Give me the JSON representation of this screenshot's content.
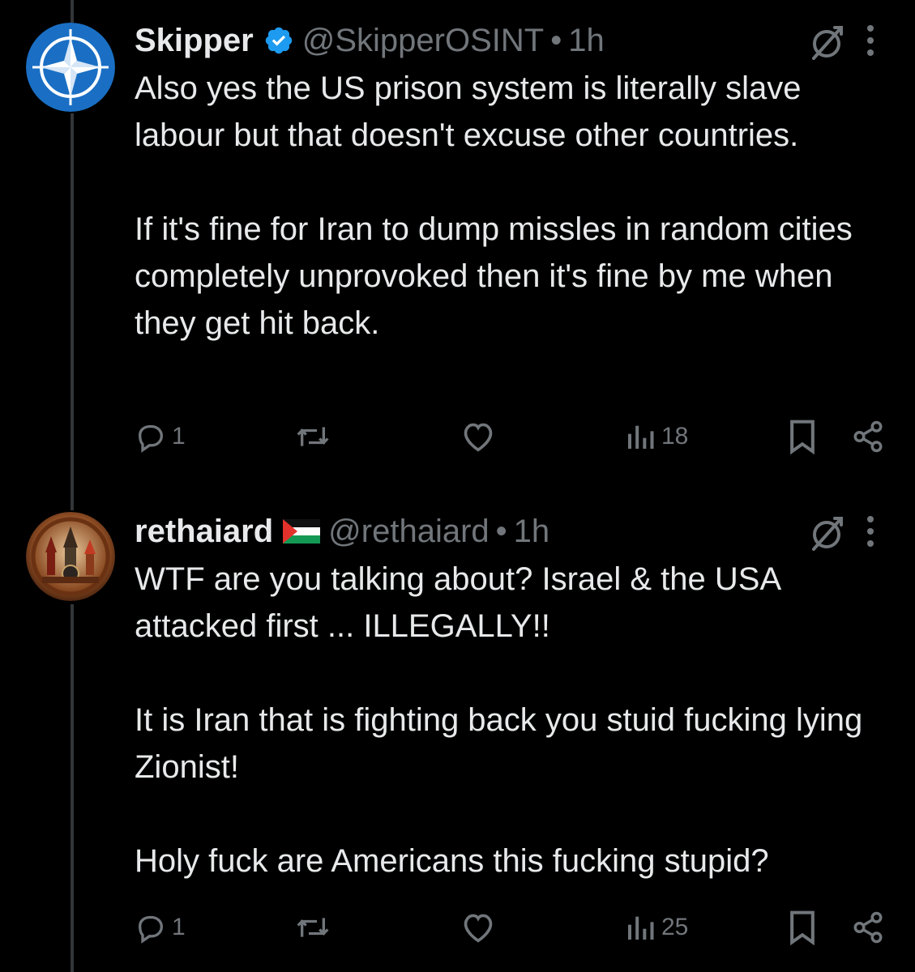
{
  "posts": [
    {
      "name": "Skipper",
      "verified": true,
      "handle": "@SkipperOSINT",
      "separator": "•",
      "time": "1h",
      "paragraphs": [
        "Also yes the US prison system is literally slave labour but that doesn't excuse other countries.",
        "If it's fine for Iran to dump missles in random cities completely unprovoked then it's fine by me when they get hit back."
      ],
      "actions": {
        "replies": "1",
        "retweets": "",
        "likes": "",
        "views": "18"
      },
      "avatar_icon": "compass-star-icon"
    },
    {
      "name": "rethaiard",
      "flag_icon": "palestine-flag-icon",
      "handle": "@rethaiard",
      "separator": "•",
      "time": "1h",
      "paragraphs": [
        "WTF are you talking about? Israel & the USA attacked first ... ILLEGALLY!!",
        "It is Iran that is fighting back you stuid fucking lying Zionist!",
        "Holy fuck are Americans this fucking stupid?"
      ],
      "actions": {
        "replies": "1",
        "retweets": "",
        "likes": "",
        "views": "25"
      },
      "avatar_icon": "temple-emblem-icon"
    }
  ],
  "colors": {
    "background": "#000000",
    "text": "#e7e9ea",
    "secondary": "#71767b",
    "verified": "#1d9bf0",
    "thread_line": "#333639"
  }
}
